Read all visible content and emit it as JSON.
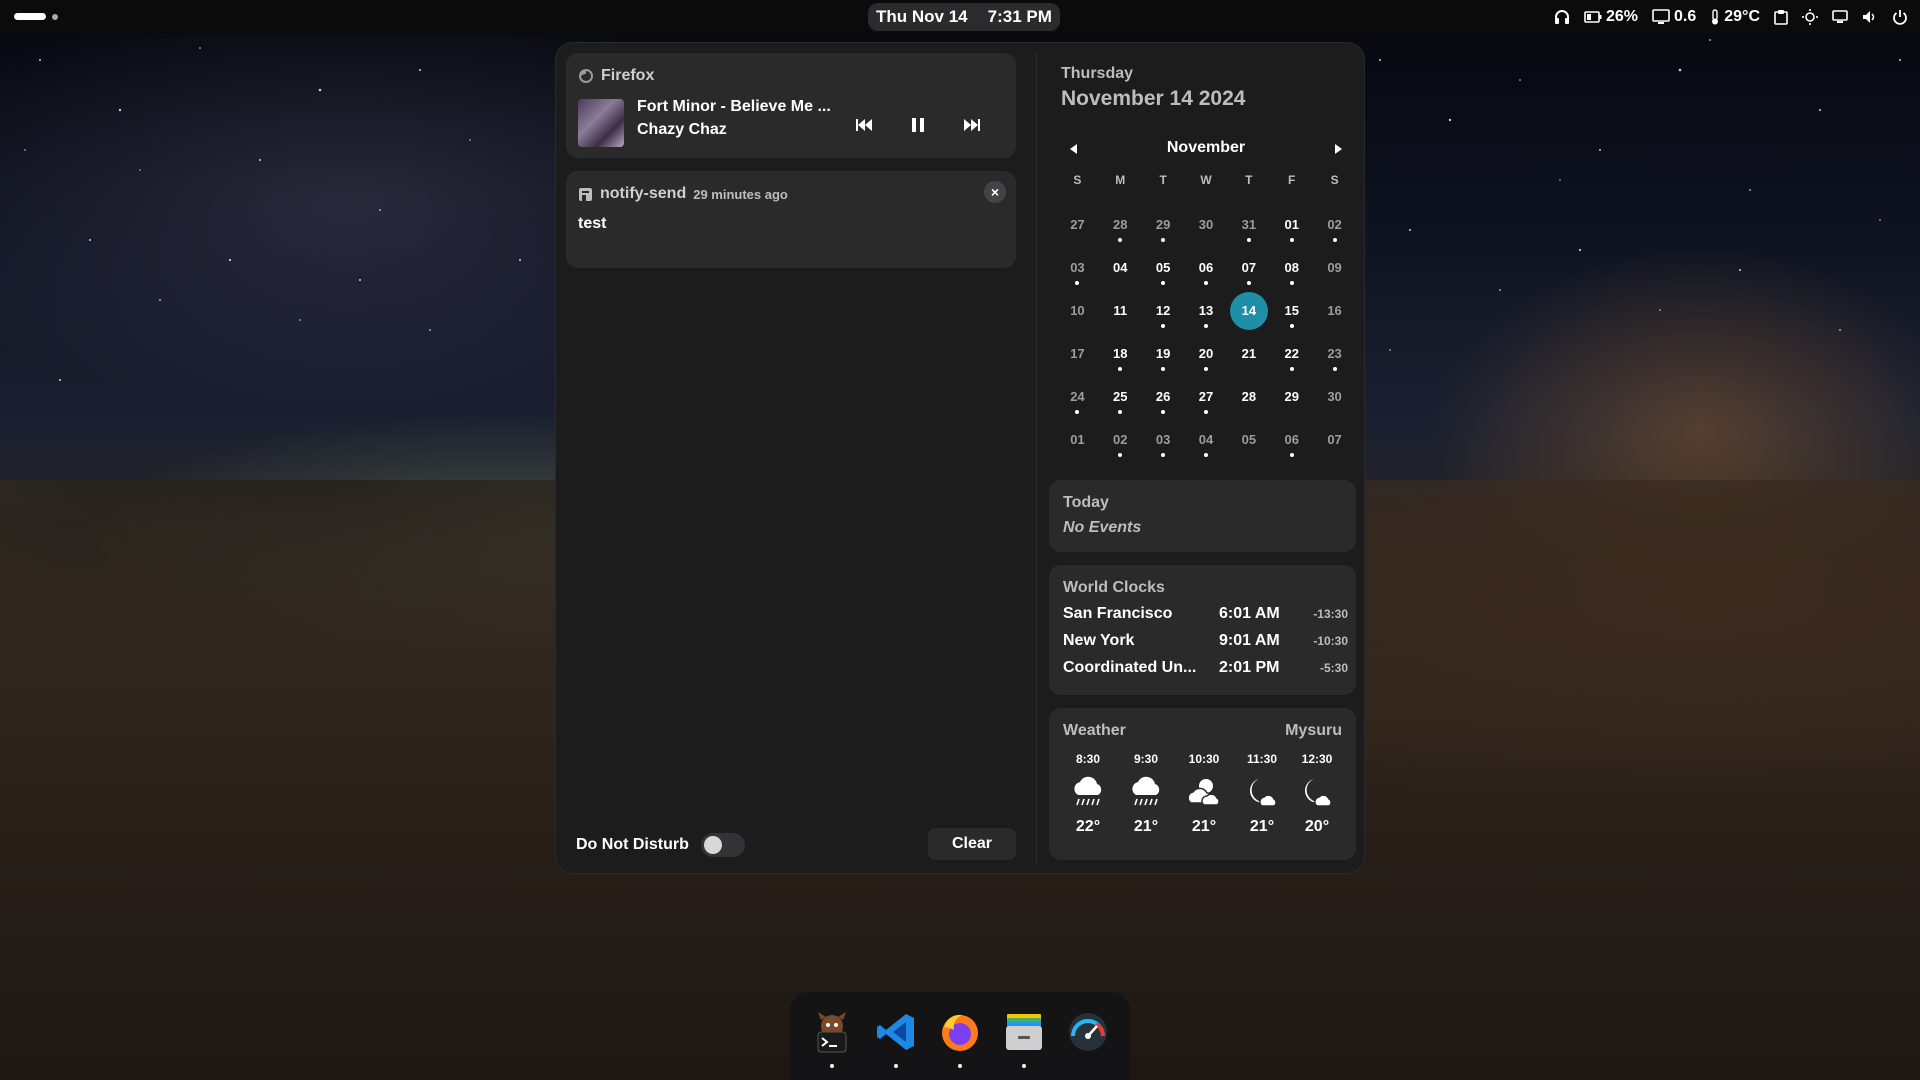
{
  "topbar": {
    "date": "Thu Nov 14",
    "time": "7:31 PM",
    "battery": "26%",
    "load": "0.6",
    "temperature": "29°C"
  },
  "media": {
    "app": "Firefox",
    "title": "Fort Minor - Believe Me ...",
    "artist": "Chazy Chaz"
  },
  "notification": {
    "app": "notify-send",
    "time": "29 minutes ago",
    "body": "test"
  },
  "footer": {
    "dnd_label": "Do Not Disturb",
    "clear_label": "Clear"
  },
  "calendar": {
    "day_name": "Thursday",
    "full_date": "November 14 2024",
    "month": "November",
    "weekdays": [
      "S",
      "M",
      "T",
      "W",
      "T",
      "F",
      "S"
    ],
    "days": [
      {
        "d": "27",
        "muted": true,
        "ev": false
      },
      {
        "d": "28",
        "muted": true,
        "ev": true
      },
      {
        "d": "29",
        "muted": true,
        "ev": true
      },
      {
        "d": "30",
        "muted": true,
        "ev": false
      },
      {
        "d": "31",
        "muted": true,
        "ev": true
      },
      {
        "d": "01",
        "muted": false,
        "ev": true
      },
      {
        "d": "02",
        "muted": true,
        "ev": true
      },
      {
        "d": "03",
        "muted": true,
        "ev": true
      },
      {
        "d": "04",
        "muted": false,
        "ev": false
      },
      {
        "d": "05",
        "muted": false,
        "ev": true
      },
      {
        "d": "06",
        "muted": false,
        "ev": true
      },
      {
        "d": "07",
        "muted": false,
        "ev": true
      },
      {
        "d": "08",
        "muted": false,
        "ev": true
      },
      {
        "d": "09",
        "muted": true,
        "ev": false
      },
      {
        "d": "10",
        "muted": true,
        "ev": false
      },
      {
        "d": "11",
        "muted": false,
        "ev": false
      },
      {
        "d": "12",
        "muted": false,
        "ev": true
      },
      {
        "d": "13",
        "muted": false,
        "ev": true
      },
      {
        "d": "14",
        "muted": false,
        "ev": false,
        "today": true
      },
      {
        "d": "15",
        "muted": false,
        "ev": true
      },
      {
        "d": "16",
        "muted": true,
        "ev": false
      },
      {
        "d": "17",
        "muted": true,
        "ev": false
      },
      {
        "d": "18",
        "muted": false,
        "ev": true
      },
      {
        "d": "19",
        "muted": false,
        "ev": true
      },
      {
        "d": "20",
        "muted": false,
        "ev": true
      },
      {
        "d": "21",
        "muted": false,
        "ev": false
      },
      {
        "d": "22",
        "muted": false,
        "ev": true
      },
      {
        "d": "23",
        "muted": true,
        "ev": true
      },
      {
        "d": "24",
        "muted": true,
        "ev": true
      },
      {
        "d": "25",
        "muted": false,
        "ev": true
      },
      {
        "d": "26",
        "muted": false,
        "ev": true
      },
      {
        "d": "27",
        "muted": false,
        "ev": true
      },
      {
        "d": "28",
        "muted": false,
        "ev": false
      },
      {
        "d": "29",
        "muted": false,
        "ev": false
      },
      {
        "d": "30",
        "muted": true,
        "ev": false
      },
      {
        "d": "01",
        "muted": true,
        "ev": false
      },
      {
        "d": "02",
        "muted": true,
        "ev": true
      },
      {
        "d": "03",
        "muted": true,
        "ev": true
      },
      {
        "d": "04",
        "muted": true,
        "ev": true
      },
      {
        "d": "05",
        "muted": true,
        "ev": false
      },
      {
        "d": "06",
        "muted": true,
        "ev": true
      },
      {
        "d": "07",
        "muted": true,
        "ev": false
      }
    ]
  },
  "today_events": {
    "heading": "Today",
    "value": "No Events"
  },
  "world_clocks": {
    "heading": "World Clocks",
    "rows": [
      {
        "city": "San Francisco",
        "time": "6:01 AM",
        "offset": "-13:30"
      },
      {
        "city": "New York",
        "time": "9:01 AM",
        "offset": "-10:30"
      },
      {
        "city": "Coordinated Un...",
        "time": "2:01 PM",
        "offset": "-5:30"
      }
    ]
  },
  "weather": {
    "heading": "Weather",
    "location": "Mysuru",
    "hours": [
      {
        "time": "8:30",
        "temp": "22°",
        "icon": "rain-cloud-icon"
      },
      {
        "time": "9:30",
        "temp": "21°",
        "icon": "rain-cloud-icon"
      },
      {
        "time": "10:30",
        "temp": "21°",
        "icon": "partly-cloudy-icon"
      },
      {
        "time": "11:30",
        "temp": "21°",
        "icon": "moon-cloud-icon"
      },
      {
        "time": "12:30",
        "temp": "20°",
        "icon": "moon-cloud-icon"
      }
    ]
  },
  "dock": {
    "apps": [
      {
        "icon": "terminal-icon",
        "running": true
      },
      {
        "icon": "vscode-icon",
        "running": true
      },
      {
        "icon": "firefox-icon",
        "running": true
      },
      {
        "icon": "files-icon",
        "running": true
      },
      {
        "icon": "system-monitor-icon",
        "running": false
      }
    ]
  },
  "colors": {
    "accent": "#1f8fa8",
    "panel": "#1c1c1d",
    "card": "#2a2a2b"
  }
}
